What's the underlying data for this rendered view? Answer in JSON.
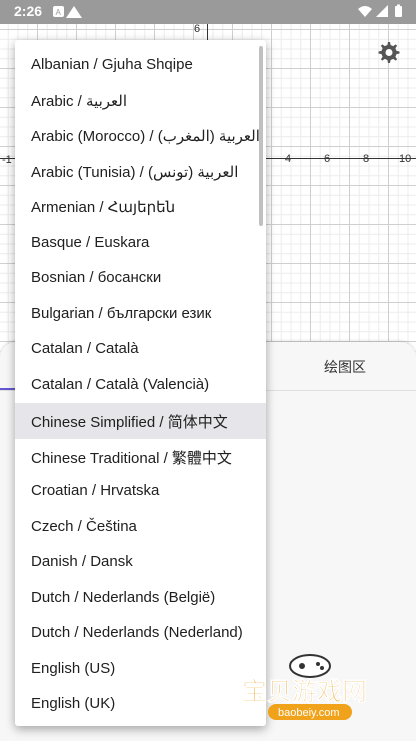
{
  "status_bar": {
    "time": "2:26"
  },
  "graph": {
    "y_tick": "6",
    "x_ticks": [
      "-1",
      "4",
      "6",
      "8",
      "10"
    ]
  },
  "bottom_panel": {
    "tab_label": "绘图区"
  },
  "language_menu": {
    "items": [
      "Albanian / Gjuha Shqipe",
      "Arabic / العربية",
      "Arabic (Morocco) / (العربية (المغرب",
      "Arabic (Tunisia) / (العربية (تونس",
      "Armenian / Հայերեն",
      "Basque / Euskara",
      "Bosnian / босански",
      "Bulgarian / български език",
      "Catalan / Català",
      "Catalan / Català (Valencià)",
      "Chinese Simplified / 简体中文",
      "Chinese Traditional / 繁體中文",
      "Croatian / Hrvatska",
      "Czech / Čeština",
      "Danish / Dansk",
      "Dutch / Nederlands (België)",
      "Dutch / Nederlands (Nederland)",
      "English (US)",
      "English (UK)"
    ],
    "selected_index": 10
  },
  "watermark": {
    "brand": "宝贝游戏网",
    "url": "baobeiy.com"
  }
}
